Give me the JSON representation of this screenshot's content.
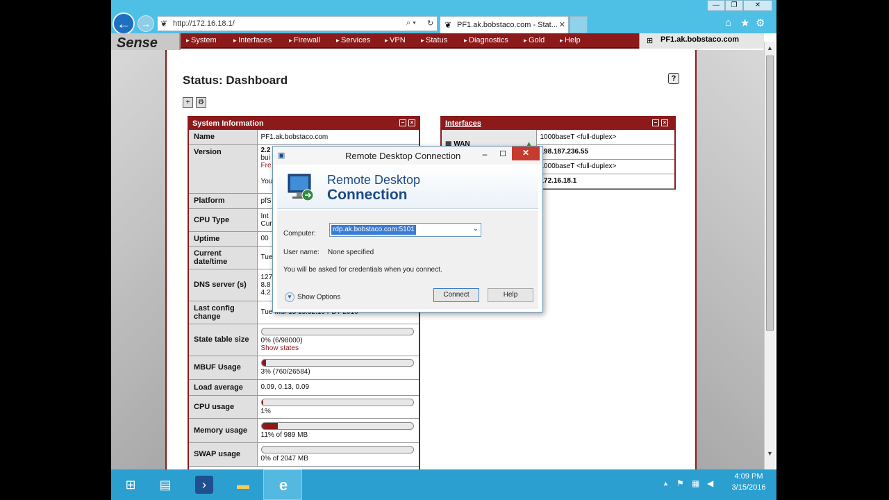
{
  "browser": {
    "url": "http://172.16.18.1/",
    "tab_title": "PF1.ak.bobstaco.com - Stat...",
    "window_controls": [
      "—",
      "❐",
      "✕"
    ]
  },
  "pfsense": {
    "logo": "Sense",
    "nav": [
      "System",
      "Interfaces",
      "Firewall",
      "Services",
      "VPN",
      "Status",
      "Diagnostics",
      "Gold",
      "Help"
    ],
    "hostname": "PF1.ak.bobstaco.com",
    "page_title": "Status: Dashboard"
  },
  "system_info": {
    "title": "System Information",
    "rows": {
      "name": {
        "label": "Name",
        "value": "PF1.ak.bobstaco.com"
      },
      "version": {
        "label": "Version",
        "value1": "2.2",
        "value2": "bui",
        "value3": "Fre",
        "value4": "You"
      },
      "platform": {
        "label": "Platform",
        "value": "pfS"
      },
      "cpu_type": {
        "label": "CPU Type",
        "value1": "Int",
        "value2": "Cur"
      },
      "uptime": {
        "label": "Uptime",
        "value": "00"
      },
      "datetime": {
        "label": "Current date/time",
        "value": "Tue"
      },
      "dns": {
        "label": "DNS server (s)",
        "value1": "127",
        "value2": "8.8",
        "value3": "4.2"
      },
      "last_config": {
        "label": "Last config change",
        "value": "Tue Mar 15 15:52:19 PDT 2016"
      },
      "state_table": {
        "label": "State table size",
        "value": "0% (6/98000)",
        "link": "Show states",
        "percent": 0
      },
      "mbuf": {
        "label": "MBUF Usage",
        "value": "3% (760/26584)",
        "percent": 3
      },
      "load": {
        "label": "Load average",
        "value": "0.09, 0.13, 0.09"
      },
      "cpu": {
        "label": "CPU usage",
        "value": "1%",
        "percent": 1
      },
      "memory": {
        "label": "Memory usage",
        "value": "11% of 989 MB",
        "percent": 11
      },
      "swap": {
        "label": "SWAP usage",
        "value": "0% of 2047 MB",
        "percent": 0
      }
    }
  },
  "interfaces": {
    "title": "Interfaces",
    "rows": [
      {
        "name": "WAN",
        "media": "1000baseT <full-duplex>",
        "ip": "198.187.236.55"
      },
      {
        "name": "",
        "media": "1000baseT <full-duplex>",
        "ip": "172.16.18.1"
      }
    ]
  },
  "rdp": {
    "title": "Remote Desktop Connection",
    "heading_line1": "Remote Desktop",
    "heading_line2": "Connection",
    "computer_label": "Computer:",
    "computer_value": "rdp.ak.bobstaco.com:5101",
    "user_label": "User name:",
    "user_value": "None specified",
    "note": "You will be asked for credentials when you connect.",
    "show_options": "Show Options",
    "connect": "Connect",
    "help": "Help"
  },
  "taskbar": {
    "time": "4:09 PM",
    "date": "3/15/2016"
  }
}
